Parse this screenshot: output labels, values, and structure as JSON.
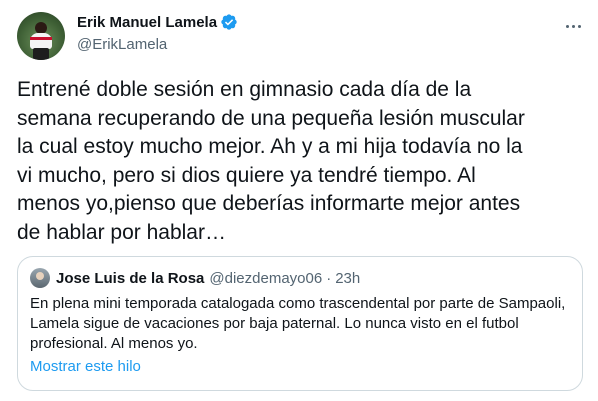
{
  "author": {
    "display_name": "Erik Manuel Lamela",
    "handle": "@ErikLamela",
    "verified": true,
    "verified_icon": "verified-badge-icon"
  },
  "tweet": {
    "text": "Entrené doble sesión en gimnasio cada día de la\nsemana recuperando de una pequeña lesión muscular\nla cual estoy mucho mejor. Ah y a mi hija todavía no la\nvi mucho, pero si dios quiere ya tendré tiempo. Al\nmenos yo,pienso que deberías informarte mejor antes\nde hablar por hablar…"
  },
  "more_icon": "more-options-icon",
  "quoted_tweet": {
    "display_name": "Jose Luis de la Rosa",
    "handle": "@diezdemayo06",
    "separator": "·",
    "time": "23h",
    "text": "En plena mini temporada catalogada como trascendental por parte de Sampaoli,\nLamela sigue de vacaciones por baja paternal. Lo nunca visto en el futbol\nprofesional. Al menos yo.",
    "show_thread_label": "Mostrar este hilo"
  },
  "colors": {
    "text": "#0f1419",
    "secondary": "#536471",
    "link": "#1d9bf0",
    "verified": "#1d9bf0",
    "border": "#cfd9de"
  }
}
